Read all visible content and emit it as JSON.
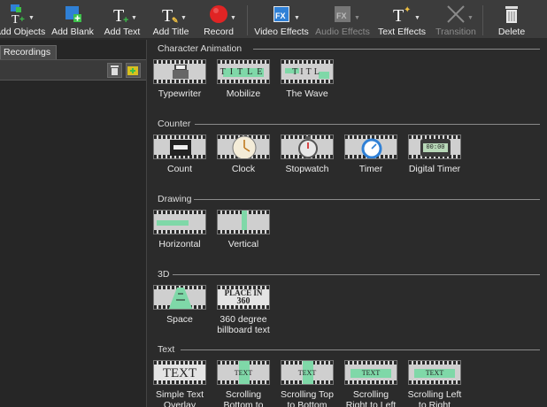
{
  "toolbar": {
    "add_objects": "Add Objects",
    "add_blank": "Add Blank",
    "add_text": "Add Text",
    "add_title": "Add Title",
    "record": "Record",
    "video_effects": "Video Effects",
    "audio_effects": "Audio Effects",
    "text_effects": "Text Effects",
    "transition": "Transition",
    "delete": "Delete"
  },
  "left_panel": {
    "tab": "Recordings"
  },
  "sections": {
    "character_animation": {
      "title": "Character Animation",
      "items": [
        "Typewriter",
        "Mobilize",
        "The Wave"
      ]
    },
    "counter": {
      "title": "Counter",
      "items": [
        "Count",
        "Clock",
        "Stopwatch",
        "Timer",
        "Digital Timer"
      ]
    },
    "drawing": {
      "title": "Drawing",
      "items": [
        "Horizontal",
        "Vertical"
      ]
    },
    "three_d": {
      "title": "3D",
      "items": [
        "Space",
        "360 degree billboard text"
      ]
    },
    "text": {
      "title": "Text",
      "items": [
        "Simple Text Overlay",
        "Scrolling Bottom to Top",
        "Scrolling Top to Bottom",
        "Scrolling Right to Left",
        "Scrolling Left to Right"
      ]
    }
  },
  "thumbs": {
    "mobilize": "TITLE",
    "wave": "TITL",
    "digital_timer": "00:00",
    "place": "PLACE IN",
    "place_num": "360",
    "text": "TEXT"
  },
  "colors": {
    "accent_green": "#7fd8a8",
    "record_red": "#e02424",
    "effects_blue": "#2f80d6"
  }
}
